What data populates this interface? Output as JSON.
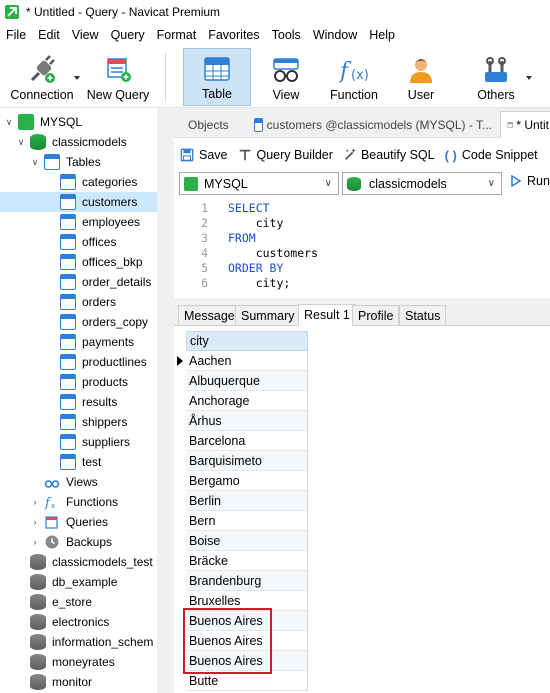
{
  "window": {
    "title": "* Untitled - Query - Navicat Premium"
  },
  "menu": [
    "File",
    "Edit",
    "View",
    "Query",
    "Format",
    "Favorites",
    "Tools",
    "Window",
    "Help"
  ],
  "ribbon": {
    "connection": "Connection",
    "new_query": "New Query",
    "table": "Table",
    "view": "View",
    "function": "Function",
    "user": "User",
    "others": "Others"
  },
  "tree": {
    "connection": "MYSQL",
    "database": "classicmodels",
    "tables_folder": "Tables",
    "tables": [
      "categories",
      "customers",
      "employees",
      "offices",
      "offices_bkp",
      "order_details",
      "orders",
      "orders_copy",
      "payments",
      "productlines",
      "products",
      "results",
      "shippers",
      "suppliers",
      "test"
    ],
    "selected_table": "customers",
    "views": "Views",
    "functions": "Functions",
    "queries": "Queries",
    "backups": "Backups",
    "other_databases": [
      "classicmodels_test",
      "db_example",
      "e_store",
      "electronics",
      "information_schem",
      "moneyrates",
      "monitor"
    ]
  },
  "tabs": {
    "objects": "Objects",
    "customers_tab": "customers @classicmodels (MYSQL) - T...",
    "untitled_tab": "* Untit"
  },
  "query_toolbar": {
    "save": "Save",
    "query_builder": "Query Builder",
    "beautify": "Beautify SQL",
    "code_snippet": "Code Snippet"
  },
  "selectors": {
    "connection": "MYSQL",
    "database": "classicmodels",
    "run": "Run"
  },
  "editor_lines": [
    {
      "n": "1",
      "kw": "SELECT",
      "text": ""
    },
    {
      "n": "2",
      "kw": "",
      "text": "    city"
    },
    {
      "n": "3",
      "kw": "FROM",
      "text": ""
    },
    {
      "n": "4",
      "kw": "",
      "text": "    customers"
    },
    {
      "n": "5",
      "kw": "ORDER BY",
      "text": ""
    },
    {
      "n": "6",
      "kw": "",
      "text": "    city;"
    }
  ],
  "result_tabs": [
    "Message",
    "Summary",
    "Result 1",
    "Profile",
    "Status"
  ],
  "result_active": "Result 1",
  "grid": {
    "column": "city",
    "rows": [
      "Aachen",
      "Albuquerque",
      "Anchorage",
      "Århus",
      "Barcelona",
      "Barquisimeto",
      "Bergamo",
      "Berlin",
      "Bern",
      "Boise",
      "Bräcke",
      "Brandenburg",
      "Bruxelles",
      "Buenos Aires",
      "Buenos Aires",
      "Buenos Aires",
      "Butte"
    ]
  },
  "colors": {
    "accent": "#2f7fd6",
    "selection": "#cce8ff",
    "highlight": "#d11a2a",
    "keyword": "#1a4fd0"
  }
}
